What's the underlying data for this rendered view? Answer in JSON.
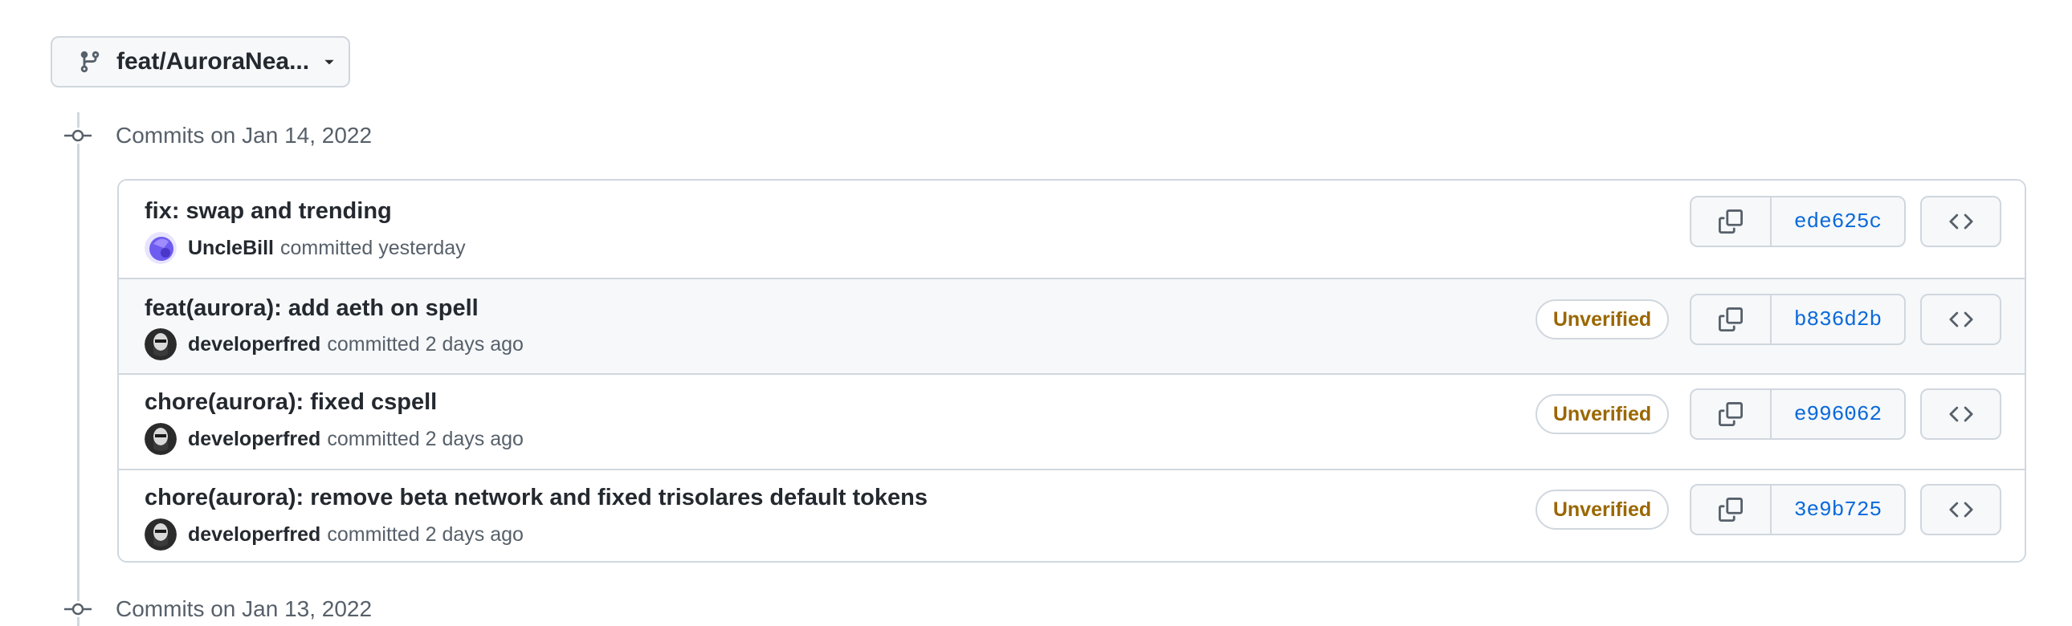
{
  "branch": {
    "label": "feat/AuroraNea...",
    "icon": "git-branch-icon"
  },
  "groups": [
    {
      "label": "Commits on Jan 14, 2022"
    },
    {
      "label": "Commits on Jan 13, 2022"
    }
  ],
  "commits": [
    {
      "title": "fix: swap and trending",
      "author": "UncleBill",
      "when": "committed yesterday",
      "sha": "ede625c",
      "badge": ""
    },
    {
      "title": "feat(aurora): add aeth on spell",
      "author": "developerfred",
      "when": "committed 2 days ago",
      "sha": "b836d2b",
      "badge": "Unverified"
    },
    {
      "title": "chore(aurora): fixed cspell",
      "author": "developerfred",
      "when": "committed 2 days ago",
      "sha": "e996062",
      "badge": "Unverified"
    },
    {
      "title": "chore(aurora): remove beta network and fixed trisolares default tokens",
      "author": "developerfred",
      "when": "committed 2 days ago",
      "sha": "3e9b725",
      "badge": "Unverified"
    }
  ],
  "colors": {
    "border": "#d0d7de",
    "sha_link": "#0969da",
    "unverified": "#9a6700",
    "row_hover": "#f6f8fa"
  }
}
